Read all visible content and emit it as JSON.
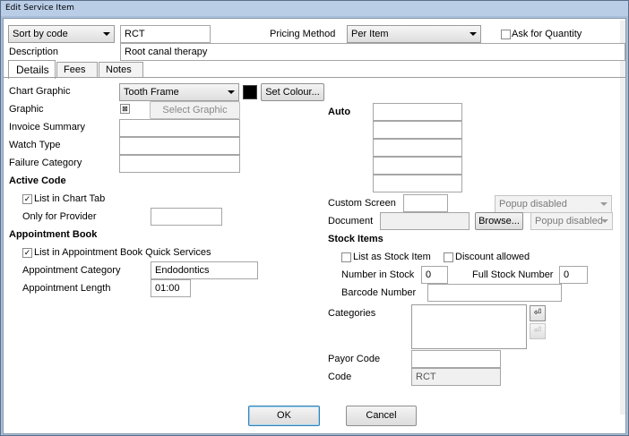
{
  "window": {
    "title": "Edit Service Item"
  },
  "header": {
    "sort_select": "Sort by code",
    "code_value": "RCT",
    "pricing_method_label": "Pricing Method",
    "pricing_method_value": "Per Item",
    "ask_quantity_label": "Ask for Quantity",
    "description_label": "Description",
    "description_value": "Root canal therapy"
  },
  "tabs": [
    {
      "label": "Details"
    },
    {
      "label": "Fees"
    },
    {
      "label": "Notes"
    }
  ],
  "details": {
    "chart_graphic_label": "Chart Graphic",
    "chart_graphic_value": "Tooth Frame",
    "set_colour_label": "Set Colour...",
    "colour": "#000000",
    "graphic_label": "Graphic",
    "select_graphic_label": "Select Graphic",
    "invoice_summary_label": "Invoice Summary",
    "watch_type_label": "Watch Type",
    "failure_category_label": "Failure Category",
    "active_code_heading": "Active Code",
    "list_in_chart_tab_label": "List in Chart Tab",
    "only_for_provider_label": "Only for Provider",
    "appointment_book_heading": "Appointment Book",
    "list_in_quick_services_label": "List in Appointment Book Quick Services",
    "appointment_category_label": "Appointment Category",
    "appointment_category_value": "Endodontics",
    "appointment_length_label": "Appointment Length",
    "appointment_length_value": "01:00"
  },
  "right": {
    "auto_heading": "Auto",
    "custom_screen_label": "Custom Screen",
    "custom_screen_popup": "Popup disabled",
    "document_label": "Document",
    "browse_label": "Browse...",
    "document_popup": "Popup disabled",
    "stock_items_heading": "Stock Items",
    "list_as_stock_label": "List as Stock Item",
    "discount_allowed_label": "Discount allowed",
    "number_in_stock_label": "Number in Stock",
    "number_in_stock_value": "0",
    "full_stock_number_label": "Full Stock Number",
    "full_stock_number_value": "0",
    "barcode_number_label": "Barcode Number",
    "categories_label": "Categories",
    "payor_code_label": "Payor Code",
    "code_label": "Code",
    "code_value": "RCT"
  },
  "footer": {
    "ok_label": "OK",
    "cancel_label": "Cancel"
  }
}
